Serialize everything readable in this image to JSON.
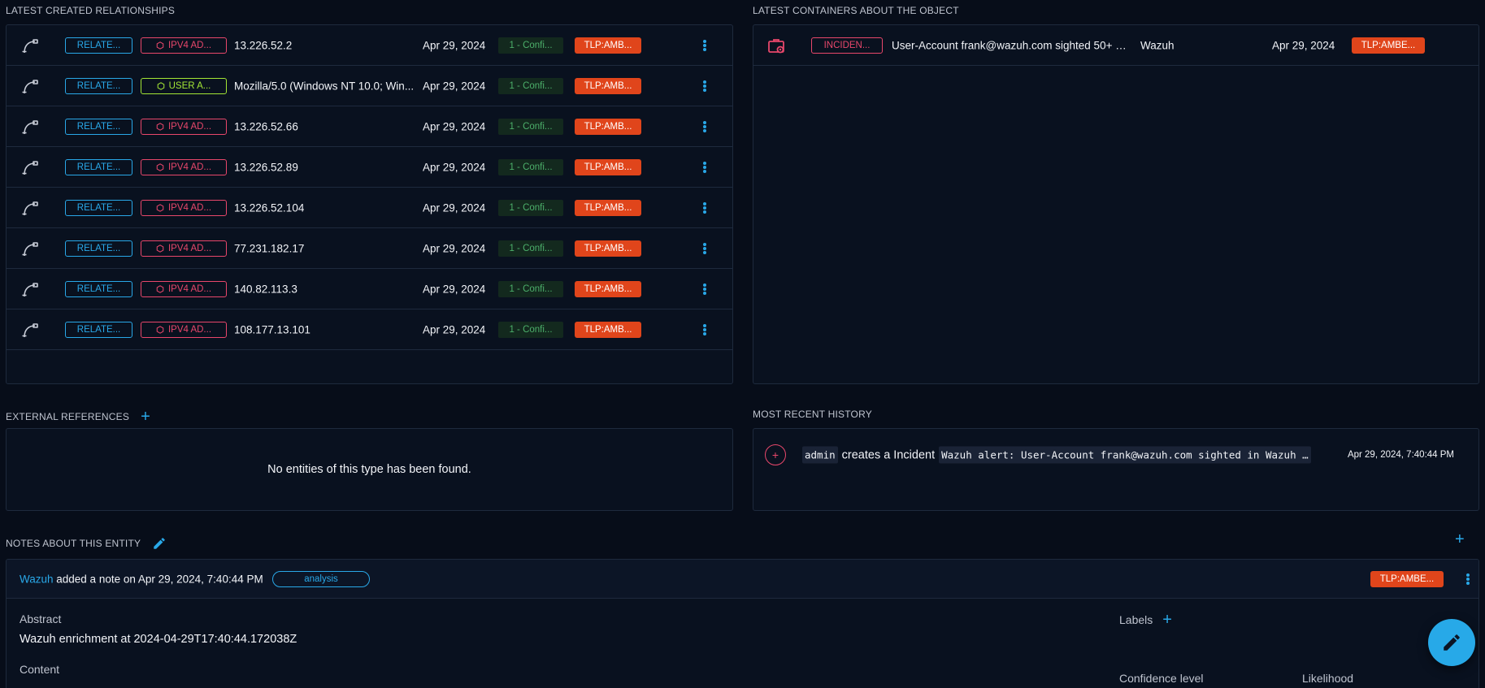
{
  "relationships": {
    "title": "LATEST CREATED RELATIONSHIPS",
    "rows": [
      {
        "rel_type": "RELATE...",
        "entity_type": "IPV4 AD...",
        "entity_kind": "ip",
        "value": "13.226.52.2",
        "date": "Apr 29, 2024",
        "confidence": "1 - Confi...",
        "marking": "TLP:AMB..."
      },
      {
        "rel_type": "RELATE...",
        "entity_type": "USER A...",
        "entity_kind": "ua",
        "value": "Mozilla/5.0 (Windows NT 10.0; Win...",
        "date": "Apr 29, 2024",
        "confidence": "1 - Confi...",
        "marking": "TLP:AMB..."
      },
      {
        "rel_type": "RELATE...",
        "entity_type": "IPV4 AD...",
        "entity_kind": "ip",
        "value": "13.226.52.66",
        "date": "Apr 29, 2024",
        "confidence": "1 - Confi...",
        "marking": "TLP:AMB..."
      },
      {
        "rel_type": "RELATE...",
        "entity_type": "IPV4 AD...",
        "entity_kind": "ip",
        "value": "13.226.52.89",
        "date": "Apr 29, 2024",
        "confidence": "1 - Confi...",
        "marking": "TLP:AMB..."
      },
      {
        "rel_type": "RELATE...",
        "entity_type": "IPV4 AD...",
        "entity_kind": "ip",
        "value": "13.226.52.104",
        "date": "Apr 29, 2024",
        "confidence": "1 - Confi...",
        "marking": "TLP:AMB..."
      },
      {
        "rel_type": "RELATE...",
        "entity_type": "IPV4 AD...",
        "entity_kind": "ip",
        "value": "77.231.182.17",
        "date": "Apr 29, 2024",
        "confidence": "1 - Confi...",
        "marking": "TLP:AMB..."
      },
      {
        "rel_type": "RELATE...",
        "entity_type": "IPV4 AD...",
        "entity_kind": "ip",
        "value": "140.82.113.3",
        "date": "Apr 29, 2024",
        "confidence": "1 - Confi...",
        "marking": "TLP:AMB..."
      },
      {
        "rel_type": "RELATE...",
        "entity_type": "IPV4 AD...",
        "entity_kind": "ip",
        "value": "108.177.13.101",
        "date": "Apr 29, 2024",
        "confidence": "1 - Confi...",
        "marking": "TLP:AMB..."
      }
    ]
  },
  "containers": {
    "title": "LATEST CONTAINERS ABOUT THE OBJECT",
    "rows": [
      {
        "type": "INCIDEN...",
        "name": "User-Account frank@wazuh.com sighted 50+ ti...",
        "author": "Wazuh",
        "date": "Apr 29, 2024",
        "marking": "TLP:AMBE..."
      }
    ]
  },
  "external_references": {
    "title": "EXTERNAL REFERENCES",
    "empty_message": "No entities of this type has been found."
  },
  "history": {
    "title": "MOST RECENT HISTORY",
    "entry": {
      "user": "admin",
      "action": "creates a Incident",
      "target": "Wazuh alert: User-Account frank@wazuh.com sighted in Wazuh SI...",
      "date": "Apr 29, 2024, 7:40:44 PM"
    }
  },
  "notes": {
    "title": "NOTES ABOUT THIS ENTITY",
    "note": {
      "author": "Wazuh",
      "added_text": " added a note on Apr 29, 2024, 7:40:44 PM",
      "type": "analysis",
      "marking": "TLP:AMBE...",
      "abstract_label": "Abstract",
      "abstract_value": "Wazuh enrichment at 2024-04-29T17:40:44.172038Z",
      "content_label": "Content",
      "labels_label": "Labels",
      "confidence_label": "Confidence level",
      "likelihood_label": "Likelihood"
    }
  },
  "colors": {
    "accent": "#29a8e8",
    "ipv4": "#e8476b",
    "user_agent": "#a3e635",
    "tlp_amber": "#e0451b",
    "confidence": "#4caf6a"
  },
  "icons": {
    "relationship": "relationship-icon",
    "incident": "incident-case-icon",
    "hexagon": "hexagon-icon",
    "history_add": "plus-circle-icon",
    "edit": "pencil-icon",
    "more": "more-vert-icon"
  }
}
